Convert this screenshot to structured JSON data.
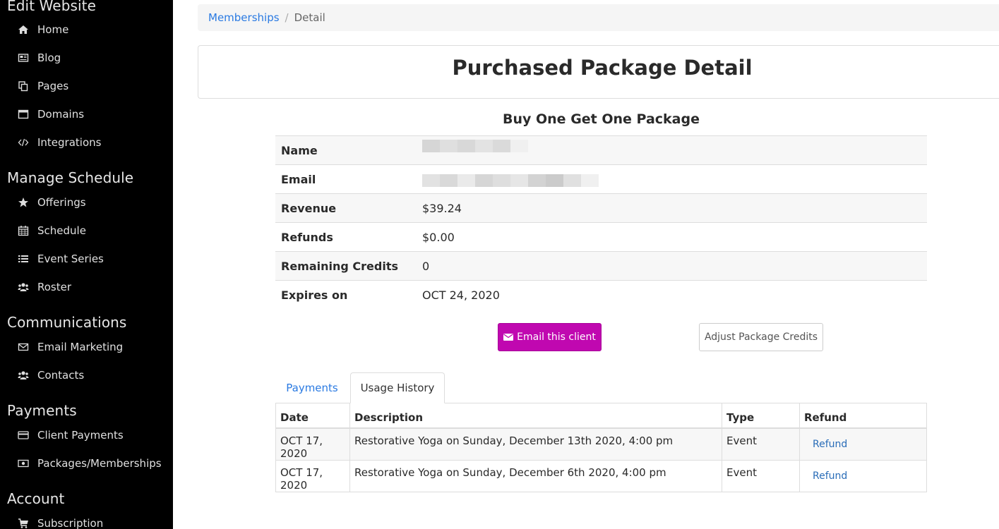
{
  "sidebar": {
    "sections": [
      {
        "title": "Edit Website",
        "items": [
          {
            "label": "Home",
            "icon": "home-icon"
          },
          {
            "label": "Blog",
            "icon": "newspaper-icon"
          },
          {
            "label": "Pages",
            "icon": "copy-icon"
          },
          {
            "label": "Domains",
            "icon": "window-icon"
          },
          {
            "label": "Integrations",
            "icon": "code-icon"
          }
        ]
      },
      {
        "title": "Manage Schedule",
        "items": [
          {
            "label": "Offerings",
            "icon": "star-icon"
          },
          {
            "label": "Schedule",
            "icon": "calendar-icon"
          },
          {
            "label": "Event Series",
            "icon": "list-icon"
          },
          {
            "label": "Roster",
            "icon": "users-icon"
          }
        ]
      },
      {
        "title": "Communications",
        "items": [
          {
            "label": "Email Marketing",
            "icon": "envelope-icon"
          },
          {
            "label": "Contacts",
            "icon": "users-icon"
          }
        ]
      },
      {
        "title": "Payments",
        "items": [
          {
            "label": "Client Payments",
            "icon": "credit-card-icon"
          },
          {
            "label": "Packages/Memberships",
            "icon": "money-icon"
          }
        ]
      },
      {
        "title": "Account",
        "items": [
          {
            "label": "Subscription",
            "icon": "cart-icon"
          }
        ]
      }
    ]
  },
  "breadcrumb": {
    "link": "Memberships",
    "separator": "/",
    "current": "Detail"
  },
  "page_title": "Purchased Package Detail",
  "package": {
    "title": "Buy One Get One Package",
    "rows": [
      {
        "label": "Name",
        "value": ""
      },
      {
        "label": "Email",
        "value": ""
      },
      {
        "label": "Revenue",
        "value": "$39.24"
      },
      {
        "label": "Refunds",
        "value": "$0.00"
      },
      {
        "label": "Remaining Credits",
        "value": "0"
      },
      {
        "label": "Expires on",
        "value": "OCT 24, 2020"
      }
    ]
  },
  "actions": {
    "email_client": "Email this client",
    "adjust_credits": "Adjust Package Credits"
  },
  "colors": {
    "primary_button": "#c008b0",
    "link": "#2a7ae2",
    "sidebar_bg": "#000000"
  },
  "tabs": {
    "payments": "Payments",
    "usage": "Usage History",
    "active": "Usage History"
  },
  "usage_table": {
    "headers": {
      "date": "Date",
      "description": "Description",
      "type": "Type",
      "refund": "Refund"
    },
    "rows": [
      {
        "date": "OCT 17, 2020",
        "description": "Restorative Yoga on Sunday, December 13th 2020, 4:00 pm",
        "type": "Event",
        "refund": "Refund"
      },
      {
        "date": "OCT 17, 2020",
        "description": "Restorative Yoga on Sunday, December 6th 2020, 4:00 pm",
        "type": "Event",
        "refund": "Refund"
      }
    ]
  }
}
